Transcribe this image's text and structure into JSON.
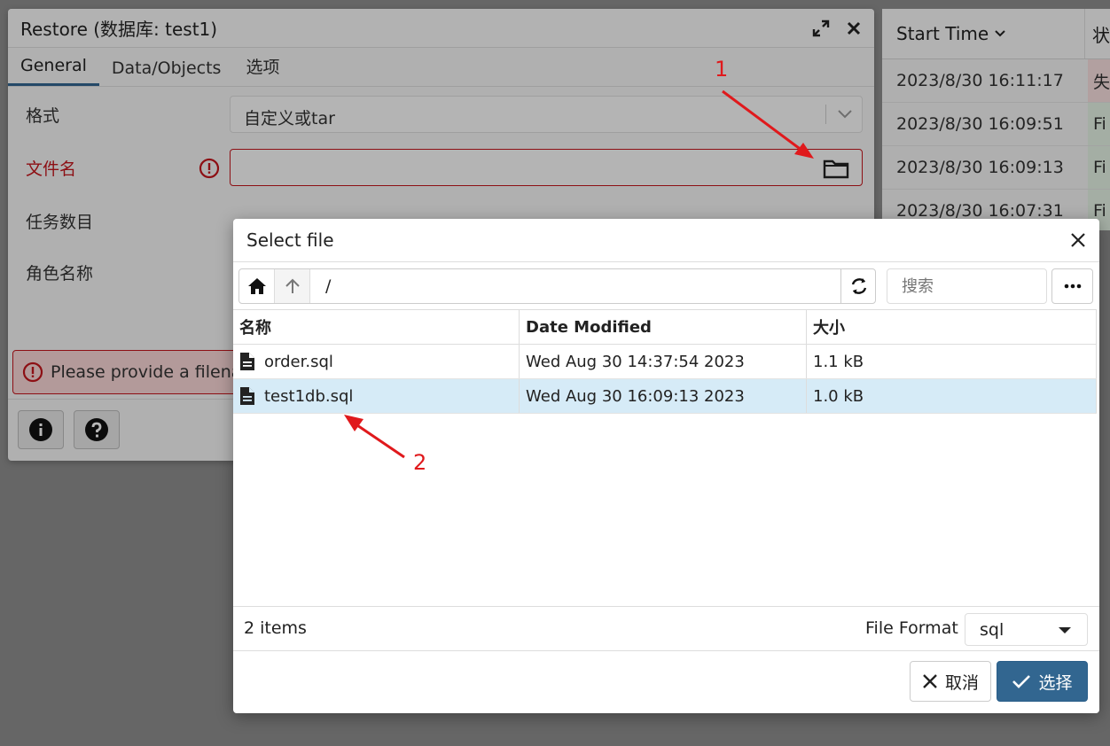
{
  "background_table": {
    "col_start_time": "Start Time",
    "col_status": "状",
    "rows": [
      {
        "time": "2023/8/30 16:11:17",
        "status": "失"
      },
      {
        "time": "2023/8/30 16:09:51",
        "status": "Fi"
      },
      {
        "time": "2023/8/30 16:09:13",
        "status": "Fi"
      },
      {
        "time": "2023/8/30 16:07:31",
        "status": "Fi"
      }
    ]
  },
  "restore_dialog": {
    "title": "Restore (数据库: test1)",
    "tabs": [
      "General",
      "Data/Objects",
      "选项"
    ],
    "format_label": "格式",
    "format_value": "自定义或tar",
    "filename_label": "文件名",
    "jobs_label": "任务数目",
    "role_label": "角色名称",
    "error_message": "Please provide a filenam"
  },
  "select_file": {
    "title": "Select file",
    "path": "/",
    "search_placeholder": "搜索",
    "columns": {
      "name": "名称",
      "date": "Date Modified",
      "size": "大小"
    },
    "files": [
      {
        "name": "order.sql",
        "date": "Wed Aug 30 14:37:54 2023",
        "size": "1.1 kB",
        "selected": false
      },
      {
        "name": "test1db.sql",
        "date": "Wed Aug 30 16:09:13 2023",
        "size": "1.0 kB",
        "selected": true
      }
    ],
    "items_count": "2 items",
    "file_format_label": "File Format",
    "file_format_value": "sql",
    "cancel_label": "取消",
    "ok_label": "选择"
  },
  "annotations": {
    "step1": "1",
    "step2": "2"
  },
  "colors": {
    "primary": "#326690",
    "error": "#c4161c",
    "selected_row": "#d6ebf7",
    "annotation": "#e0191c"
  }
}
